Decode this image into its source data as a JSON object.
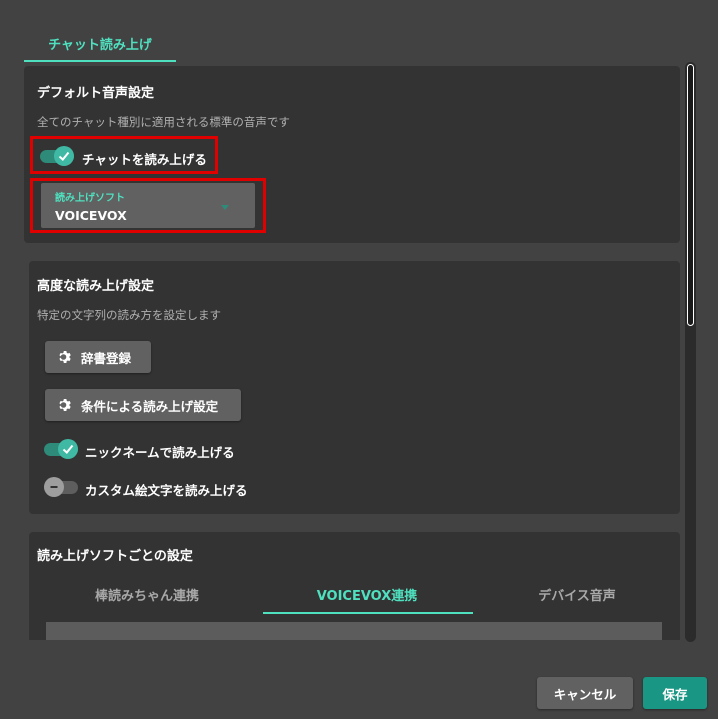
{
  "dialog": {
    "top_tab": {
      "label": "チャット読み上げ"
    }
  },
  "default_voice": {
    "title": "デフォルト音声設定",
    "description": "全てのチャット種別に適用される標準の音声です",
    "read_chat_toggle": {
      "label": "チャットを読み上げる",
      "checked": true
    },
    "software_select": {
      "label": "読み上げソフト",
      "value": "VOICEVOX"
    }
  },
  "advanced": {
    "title": "高度な読み上げ設定",
    "description": "特定の文字列の読み方を設定します",
    "dictionary_button": "辞書登録",
    "conditional_button": "条件による読み上げ設定",
    "nickname_toggle": {
      "label": "ニックネームで読み上げる",
      "checked": true
    },
    "emoji_toggle": {
      "label": "カスタム絵文字を読み上げる",
      "checked": false
    }
  },
  "per_software": {
    "title": "読み上げソフトごとの設定",
    "tabs": [
      {
        "label": "棒読みちゃん連携",
        "active": false
      },
      {
        "label": "VOICEVOX連携",
        "active": true
      },
      {
        "label": "デバイス音声",
        "active": false
      }
    ]
  },
  "footer": {
    "cancel_label": "キャンセル",
    "save_label": "保存"
  },
  "colors": {
    "accent": "#4fe0bf",
    "toggle_on": "#3fb9a3",
    "save_button": "#1a9684",
    "highlight_box": "#e00000"
  }
}
